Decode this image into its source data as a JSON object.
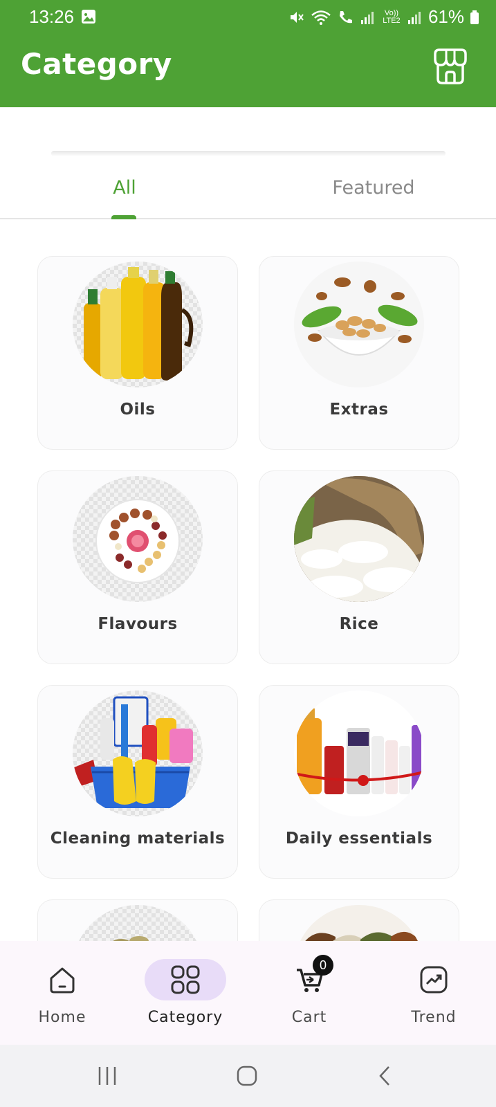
{
  "status_bar": {
    "time": "13:26",
    "battery": "61%",
    "network_label": "Vo)) LTE2"
  },
  "header": {
    "title": "Category",
    "store_icon": "store-icon"
  },
  "tabs": [
    {
      "label": "All",
      "active": true
    },
    {
      "label": "Featured",
      "active": false
    }
  ],
  "categories": [
    {
      "label": "Oils",
      "image": "oil-bottles"
    },
    {
      "label": "Extras",
      "image": "nuts-bowl"
    },
    {
      "label": "Flavours",
      "image": "spice-plate"
    },
    {
      "label": "Rice",
      "image": "rice-sack"
    },
    {
      "label": "Cleaning materials",
      "image": "cleaning-basket"
    },
    {
      "label": "Daily essentials",
      "image": "essentials-products"
    },
    {
      "label": "",
      "image": "partial-item"
    },
    {
      "label": "",
      "image": "partial-spices"
    }
  ],
  "bottom_nav": [
    {
      "label": "Home",
      "icon": "home-icon",
      "active": false
    },
    {
      "label": "Category",
      "icon": "grid-icon",
      "active": true
    },
    {
      "label": "Cart",
      "icon": "cart-icon",
      "active": false,
      "badge": "0"
    },
    {
      "label": "Trend",
      "icon": "trend-icon",
      "active": false
    }
  ],
  "colors": {
    "brand_green": "#4ea235",
    "active_pill": "#e8dcf8"
  }
}
